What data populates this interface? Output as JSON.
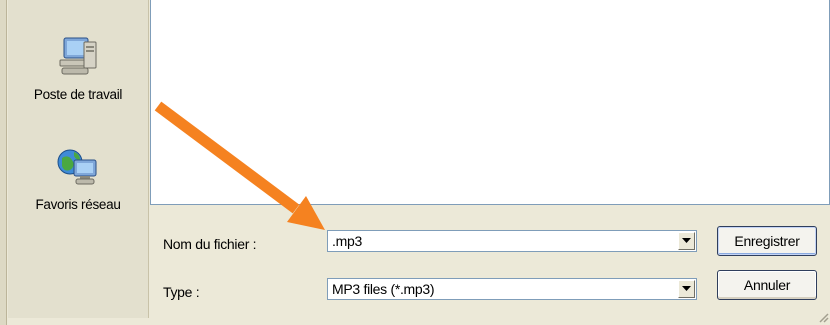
{
  "places_bar": {
    "items": [
      {
        "label": "Poste de travail",
        "icon": "my-computer-icon"
      },
      {
        "label": "Favoris réseau",
        "icon": "network-places-icon"
      }
    ]
  },
  "form": {
    "filename_label": "Nom du fichier :",
    "filename_value": ".mp3",
    "type_label": "Type :",
    "type_value": "MP3 files (*.mp3)"
  },
  "buttons": {
    "save_label": "Enregistrer",
    "cancel_label": "Annuler"
  },
  "annotation": {
    "arrow_color": "#f58220"
  },
  "colors": {
    "dialog_bg": "#ece9d8",
    "field_border": "#7f9db9"
  }
}
